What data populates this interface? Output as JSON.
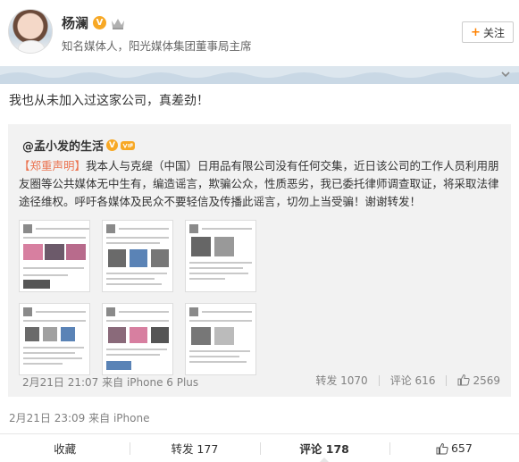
{
  "user": {
    "name": "杨澜",
    "description": "知名媒体人，阳光媒体集团董事局主席",
    "follow_label": "关注",
    "follow_plus": "+"
  },
  "post": {
    "text": "我也从未加入过这家公司，真差劲！",
    "time": "2月21日 23:09",
    "source": "来自 iPhone"
  },
  "repost": {
    "author": "@孟小发的生活",
    "body_prefix": "【郑重声明】",
    "body": "我本人与克缇（中国）日用品有限公司没有任何交集，近日该公司的工作人员利用朋友圈等公共媒体无中生有，编造谣言，欺骗公众，性质恶劣，我已委托律师调查取证，将采取法律途径维权。呼吁各媒体及民众不要轻信及传播此谣言，切勿上当受骗！谢谢转发！",
    "time": "2月21日 21:07",
    "source": "来自 iPhone 6 Plus",
    "repost_label": "转发",
    "repost_count": "1070",
    "comment_label": "评论",
    "comment_count": "616",
    "like_count": "2569"
  },
  "footer": {
    "favorite": "收藏",
    "repost": "转发 177",
    "comment": "评论 178",
    "like": "657"
  },
  "colors": {
    "accent": "#ff8200",
    "verified": "#f7a825",
    "link": "#eb7350",
    "repost_bg": "#f2f2f2"
  }
}
